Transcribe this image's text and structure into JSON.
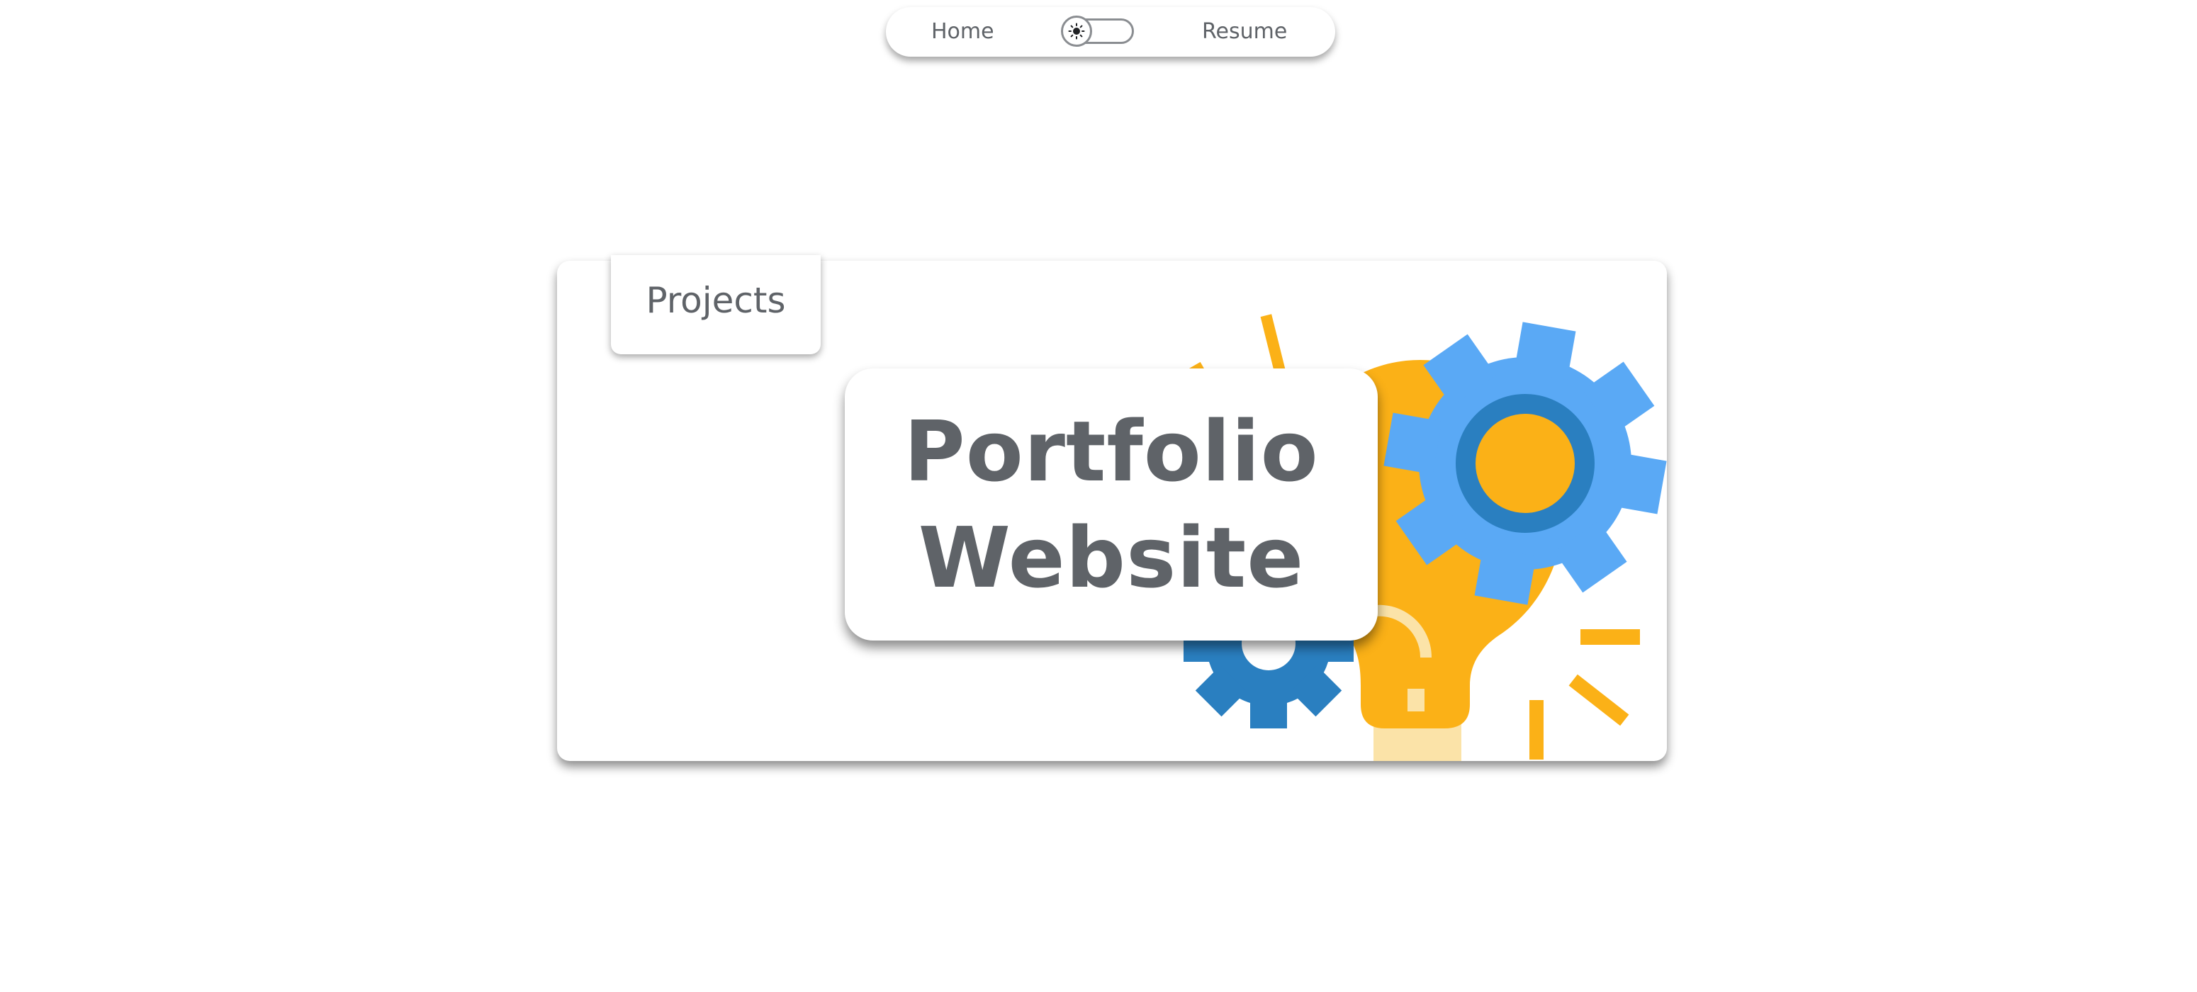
{
  "nav": {
    "home_label": "Home",
    "resume_label": "Resume",
    "theme_toggle_icon": "sun-icon"
  },
  "section": {
    "label": "Projects"
  },
  "project": {
    "title_line1": "Portfolio",
    "title_line2": "Website",
    "illustration": "lightbulb-gears-icon"
  },
  "colors": {
    "text": "#5f6368",
    "bulb": "#fbb117",
    "gear_light": "#5aa9f5",
    "gear_dark": "#2a7fc0",
    "bulb_base": "#fbe3a8"
  }
}
